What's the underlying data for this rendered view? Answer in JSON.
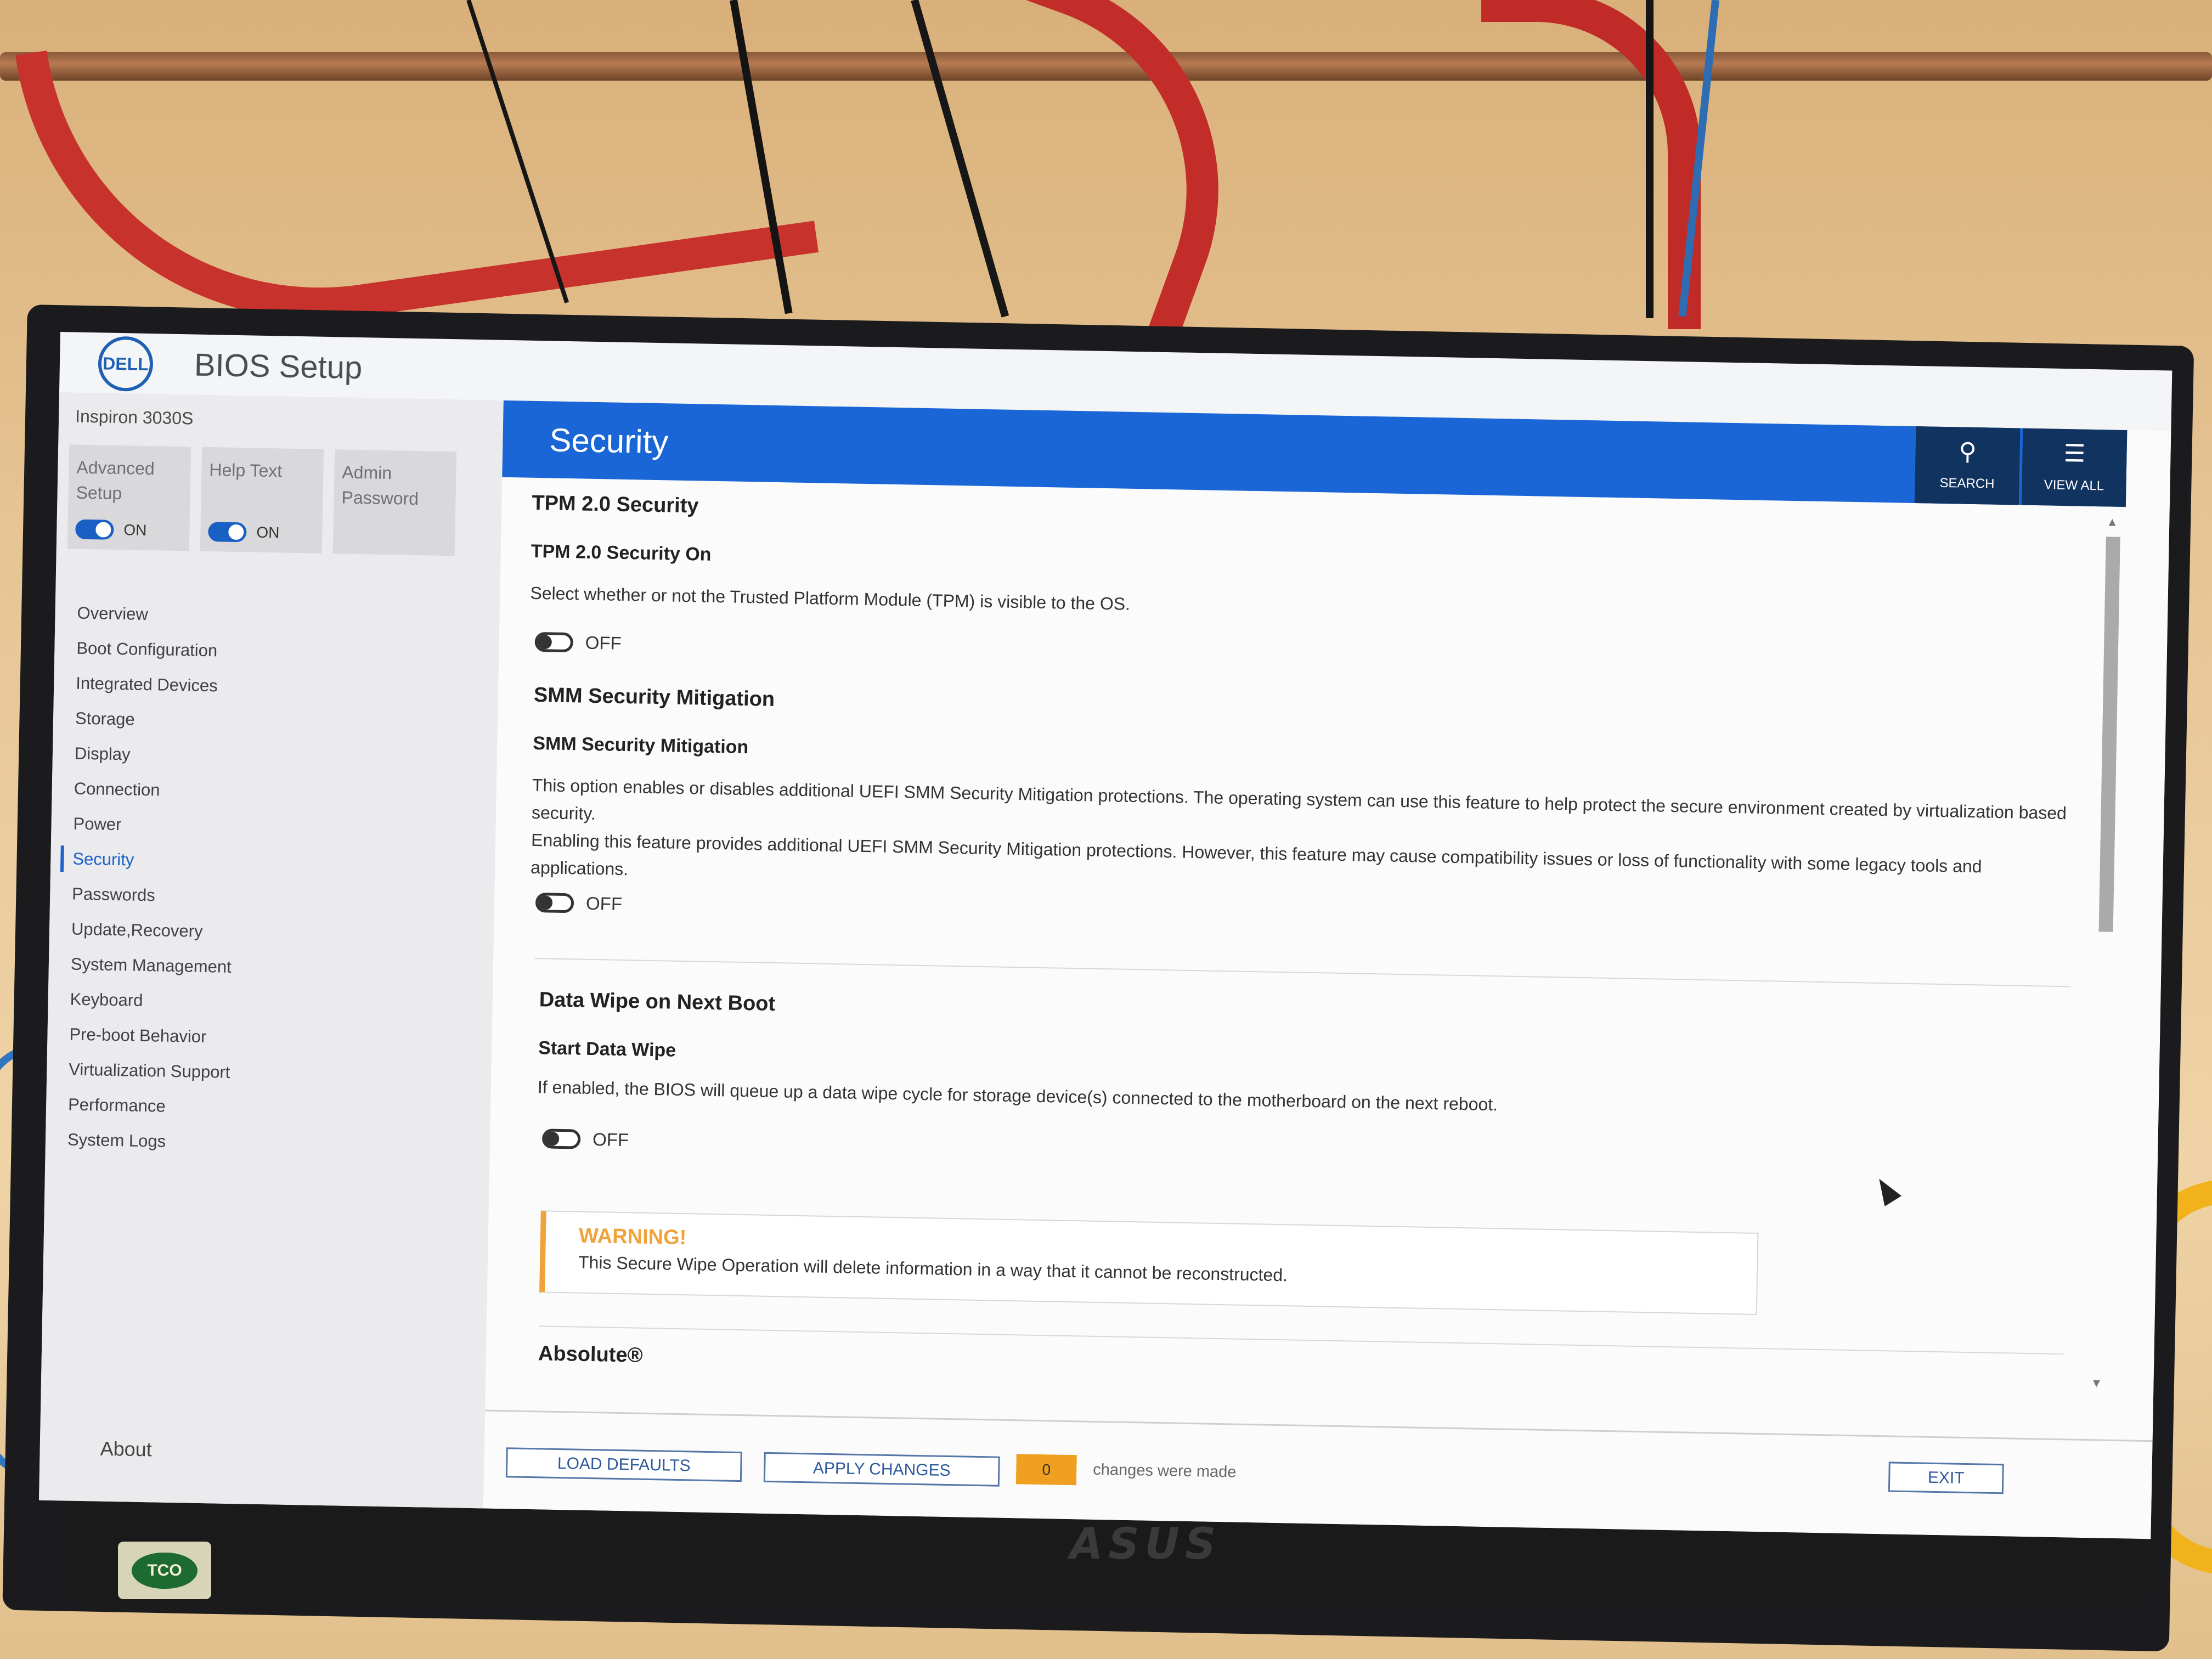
{
  "app": {
    "brand": "DELL",
    "title": "BIOS Setup",
    "model": "Inspiron 3030S"
  },
  "tiles": [
    {
      "label": "Advanced Setup",
      "toggle": "ON",
      "state": true
    },
    {
      "label": "Help Text",
      "toggle": "ON",
      "state": true
    },
    {
      "label": "Admin Password"
    }
  ],
  "nav": {
    "items": [
      "Overview",
      "Boot Configuration",
      "Integrated Devices",
      "Storage",
      "Display",
      "Connection",
      "Power",
      "Security",
      "Passwords",
      "Update,Recovery",
      "System Management",
      "Keyboard",
      "Pre-boot Behavior",
      "Virtualization Support",
      "Performance",
      "System Logs"
    ],
    "active": "Security",
    "about": "About"
  },
  "header": {
    "title": "Security",
    "search_label": "SEARCH",
    "viewall_label": "VIEW ALL"
  },
  "sections": {
    "tpm": {
      "heading": "TPM 2.0 Security",
      "setting": "TPM 2.0 Security On",
      "description": "Select whether or not the Trusted Platform Module (TPM) is visible to the OS.",
      "value": "OFF"
    },
    "smm": {
      "heading": "SMM Security Mitigation",
      "setting": "SMM Security Mitigation",
      "description1": "This option enables or disables additional UEFI SMM Security Mitigation protections. The operating system can use this feature to help protect the secure environment created by virtualization based security.",
      "description2": "Enabling this feature provides additional UEFI SMM Security Mitigation protections. However, this feature may cause compatibility issues or loss of functionality with some legacy tools and applications.",
      "value": "OFF"
    },
    "wipe": {
      "heading": "Data Wipe on Next Boot",
      "setting": "Start Data Wipe",
      "description": "If enabled, the BIOS will queue up a data wipe cycle for storage device(s) connected to the motherboard on the next reboot.",
      "value": "OFF",
      "warning_title": "WARNING!",
      "warning_text": "This Secure Wipe Operation will delete information in a way that it cannot be reconstructed."
    },
    "absolute": {
      "heading": "Absolute®"
    }
  },
  "footer": {
    "load_defaults": "LOAD DEFAULTS",
    "apply_changes": "APPLY CHANGES",
    "change_count": "0",
    "changes_note": "changes were made",
    "exit": "EXIT"
  },
  "monitor": {
    "brand": "ASUS",
    "badge": "TCO"
  },
  "colors": {
    "accent": "#1a66d6",
    "header_buttons": "#10335f",
    "warning": "#f0a33a",
    "toggle_on": "#1a5fc4"
  }
}
